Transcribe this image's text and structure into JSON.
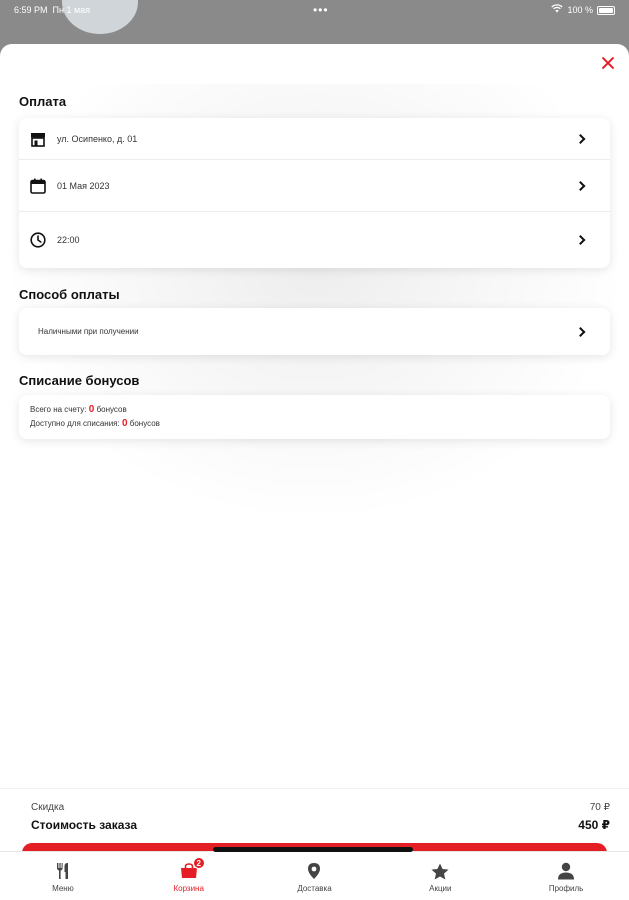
{
  "status_bar": {
    "time": "6:59 PM",
    "date": "Пн 1 мая",
    "dots": "•••",
    "battery": "100 %"
  },
  "sheet": {
    "title": "Оплата",
    "close_icon": "close-icon",
    "order_details": [
      {
        "icon": "store-icon",
        "label": "ул. Осипенко, д. 01"
      },
      {
        "icon": "calendar-icon",
        "label": "01 Мая 2023"
      },
      {
        "icon": "clock-icon",
        "label": "22:00"
      }
    ],
    "payment_method": {
      "title": "Способ оплаты",
      "value": "Наличными при получении"
    },
    "bonuses": {
      "title": "Списание бонусов",
      "total_prefix": "Всего на счету:",
      "total_value": "0",
      "total_suffix": "бонусов",
      "available_prefix": "Доступно для списания:",
      "available_value": "0",
      "available_suffix": "бонусов"
    }
  },
  "totals": {
    "discount_label": "Скидка",
    "discount_value": "70 ₽",
    "sum_label": "Стоимость заказа",
    "sum_value": "450 ₽"
  },
  "tabbar": {
    "tabs": [
      {
        "label": "Меню",
        "icon": "fork-knife-icon"
      },
      {
        "label": "Корзина",
        "icon": "cart-icon",
        "active": true,
        "badge": "2"
      },
      {
        "label": "Доставка",
        "icon": "location-pin-icon"
      },
      {
        "label": "Акции",
        "icon": "star-icon"
      },
      {
        "label": "Профиль",
        "icon": "user-icon"
      }
    ]
  },
  "colors": {
    "accent": "#e31e24",
    "text": "#111111"
  }
}
